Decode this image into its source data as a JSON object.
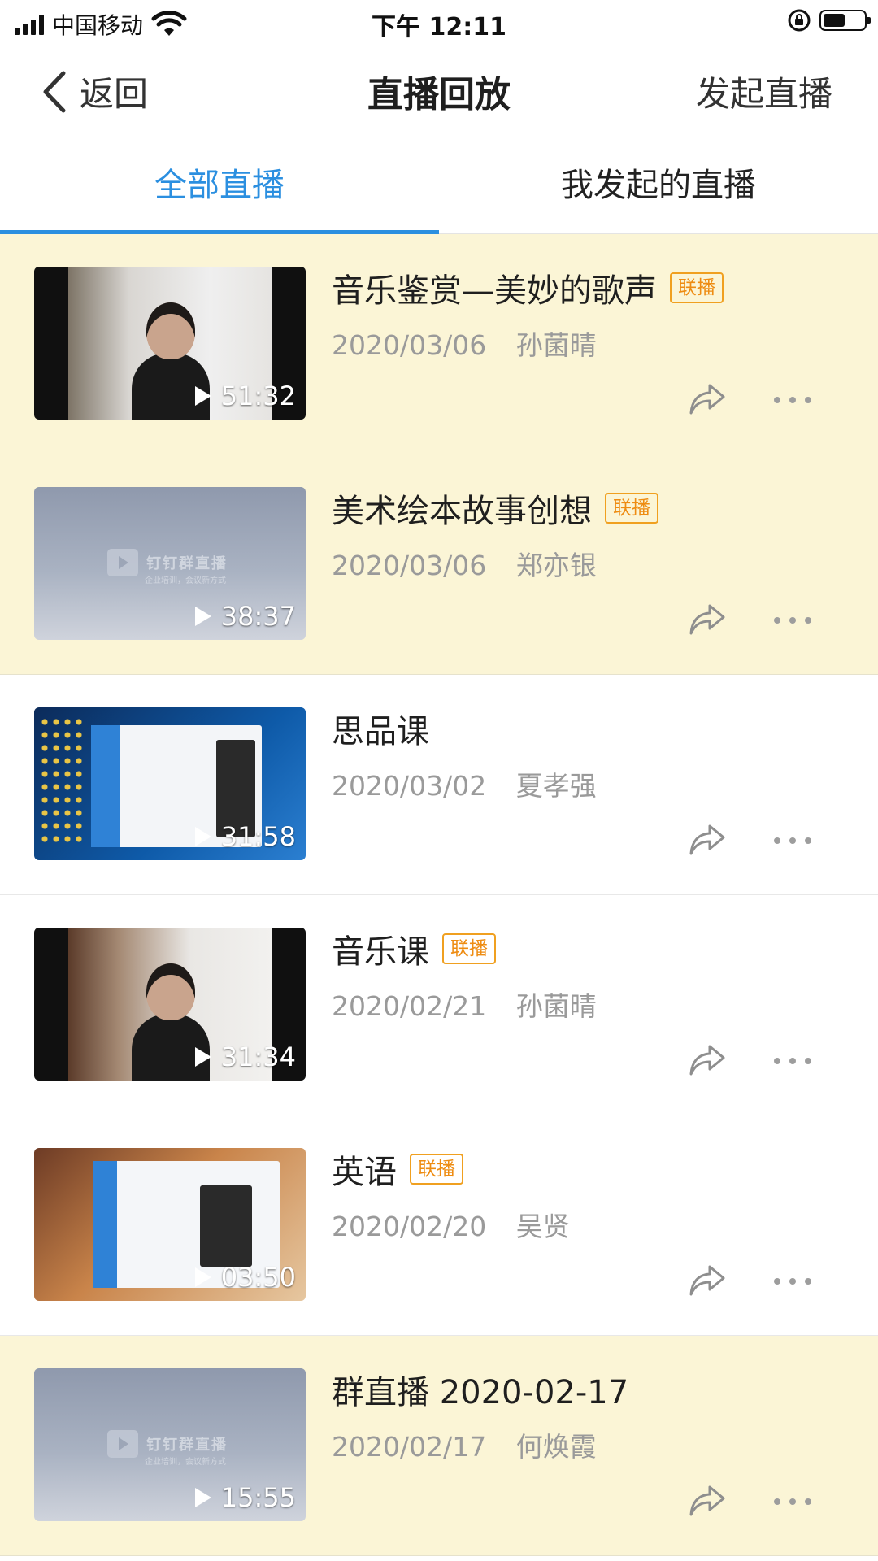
{
  "status_bar": {
    "carrier": "中国移动",
    "time": "下午 12:11"
  },
  "nav": {
    "back_label": "返回",
    "title": "直播回放",
    "action_label": "发起直播"
  },
  "tabs": [
    {
      "label": "全部直播",
      "active": true
    },
    {
      "label": "我发起的直播",
      "active": false
    }
  ],
  "accent_color": "#2b8fe0",
  "badge_color": "#ee8c12",
  "highlight_bg": "#fbf5d6",
  "items": [
    {
      "title": "音乐鉴赏—美妙的歌声",
      "badge": "联播",
      "date": "2020/03/06",
      "author": "孙菌晴",
      "duration": "51:32",
      "thumb": "video",
      "highlight": true
    },
    {
      "title": "美术绘本故事创想",
      "badge": "联播",
      "date": "2020/03/06",
      "author": "郑亦银",
      "duration": "38:37",
      "thumb": "placeholder",
      "highlight": true,
      "thumb_logo": "钉钉群直播",
      "thumb_sub": "企业培训，会议新方式"
    },
    {
      "title": "思品课",
      "badge": "",
      "date": "2020/03/02",
      "author": "夏孝强",
      "duration": "31:58",
      "thumb": "desktop",
      "highlight": false
    },
    {
      "title": "音乐课",
      "badge": "联播",
      "date": "2020/02/21",
      "author": "孙菌晴",
      "duration": "31:34",
      "thumb": "video",
      "highlight": false
    },
    {
      "title": "英语",
      "badge": "联播",
      "date": "2020/02/20",
      "author": "吴贤",
      "duration": "03:50",
      "thumb": "desktop2",
      "highlight": false
    },
    {
      "title": "群直播 2020-02-17",
      "badge": "",
      "date": "2020/02/17",
      "author": "何焕霞",
      "duration": "15:55",
      "thumb": "placeholder",
      "highlight": true,
      "thumb_logo": "钉钉群直播",
      "thumb_sub": "企业培训，会议新方式"
    }
  ],
  "icons": {
    "share": "share-arrow-icon",
    "more": "more-dots-icon",
    "play": "play-icon",
    "back": "chevron-left-icon"
  }
}
